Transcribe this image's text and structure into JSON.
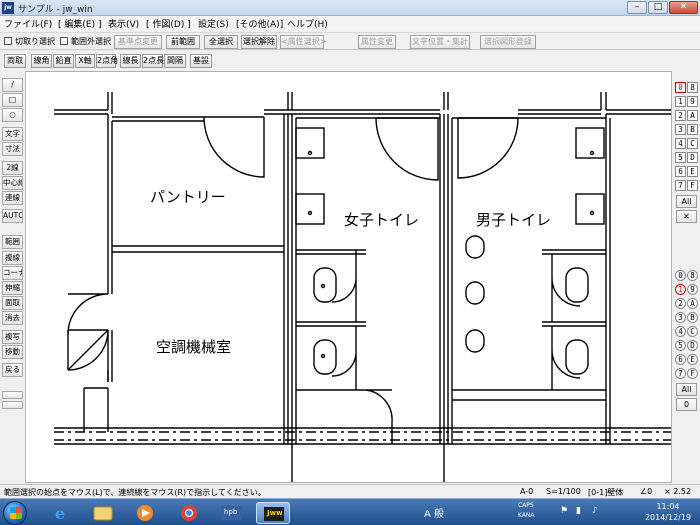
{
  "window": {
    "app_icon": "jw",
    "title": "サンプル - jw_win",
    "min_label": "–",
    "max_label": "□",
    "close_label": "✕"
  },
  "menu": [
    "ファイル(F)",
    "[ 編集(E) ]",
    "表示(V)",
    "[ 作図(D) ]",
    "設定(S)",
    "[その他(A)]",
    "ヘルプ(H)"
  ],
  "toolbar1": {
    "checkbox1": "切取り選択",
    "checkbox2": "範囲外選択",
    "buttons": [
      {
        "label": "基準点変更",
        "enabled": false
      },
      {
        "label": "前範囲",
        "enabled": true
      },
      {
        "label": "全選択",
        "enabled": true
      },
      {
        "label": "選択解除",
        "enabled": true
      },
      {
        "label": "<属性選択>",
        "enabled": false
      },
      {
        "label": "属性変更",
        "enabled": false
      },
      {
        "label": "文字位置・集計",
        "enabled": false
      },
      {
        "label": "選択図形登録",
        "enabled": false
      }
    ]
  },
  "toolbar2": [
    "両取",
    "線角",
    "鉛直",
    "X軸",
    "2点角",
    "線長",
    "2点長",
    "間隔",
    "基設"
  ],
  "left_tools": {
    "draw": [
      "/",
      "□",
      "○"
    ],
    "edit": [
      "文字",
      "寸法",
      "2線",
      "中心線",
      "連線",
      "AUTO"
    ],
    "modify": [
      "範囲",
      "複線",
      "コーナー",
      "伸縮",
      "面取",
      "消去",
      "複写",
      "移動",
      "戻る"
    ]
  },
  "rooms": {
    "pantry": "パントリー",
    "womens": "女子トイレ",
    "mens": "男子トイレ",
    "machine": "空調機械室"
  },
  "layers": {
    "group_top": [
      "0",
      "8",
      "1",
      "9",
      "2",
      "A",
      "3",
      "B",
      "4",
      "C",
      "5",
      "D",
      "6",
      "E",
      "7",
      "F"
    ],
    "all": "All",
    "cross": "✕",
    "group_bottom": [
      "0",
      "8",
      "1",
      "9",
      "2",
      "A",
      "3",
      "B",
      "4",
      "C",
      "5",
      "D",
      "6",
      "E",
      "7",
      "F"
    ],
    "all2": "All",
    "zero": "0"
  },
  "status": {
    "message": "範囲選択の始点をマウス(L)で、連続線をマウス(R)で指示してください。",
    "layer": "A-0",
    "scale": "S=1/100",
    "group": "[0-1]壁体",
    "angle": "∠0",
    "zoom": "× 2.52"
  },
  "taskbar": {
    "apps": [
      "start-orb",
      "ie-icon",
      "explorer-icon",
      "media-icon",
      "chrome-icon",
      "hpb-icon",
      "jww-icon"
    ],
    "app_labels": {
      "hpb": "hpb",
      "jww": "Jww"
    },
    "ime": "A 般",
    "caps": "CAPS",
    "kana": "KANA",
    "time": "11:04",
    "date": "2014/12/19"
  },
  "colors": {
    "accent": "#1f4f8c",
    "layer_selected": "#d00000"
  }
}
